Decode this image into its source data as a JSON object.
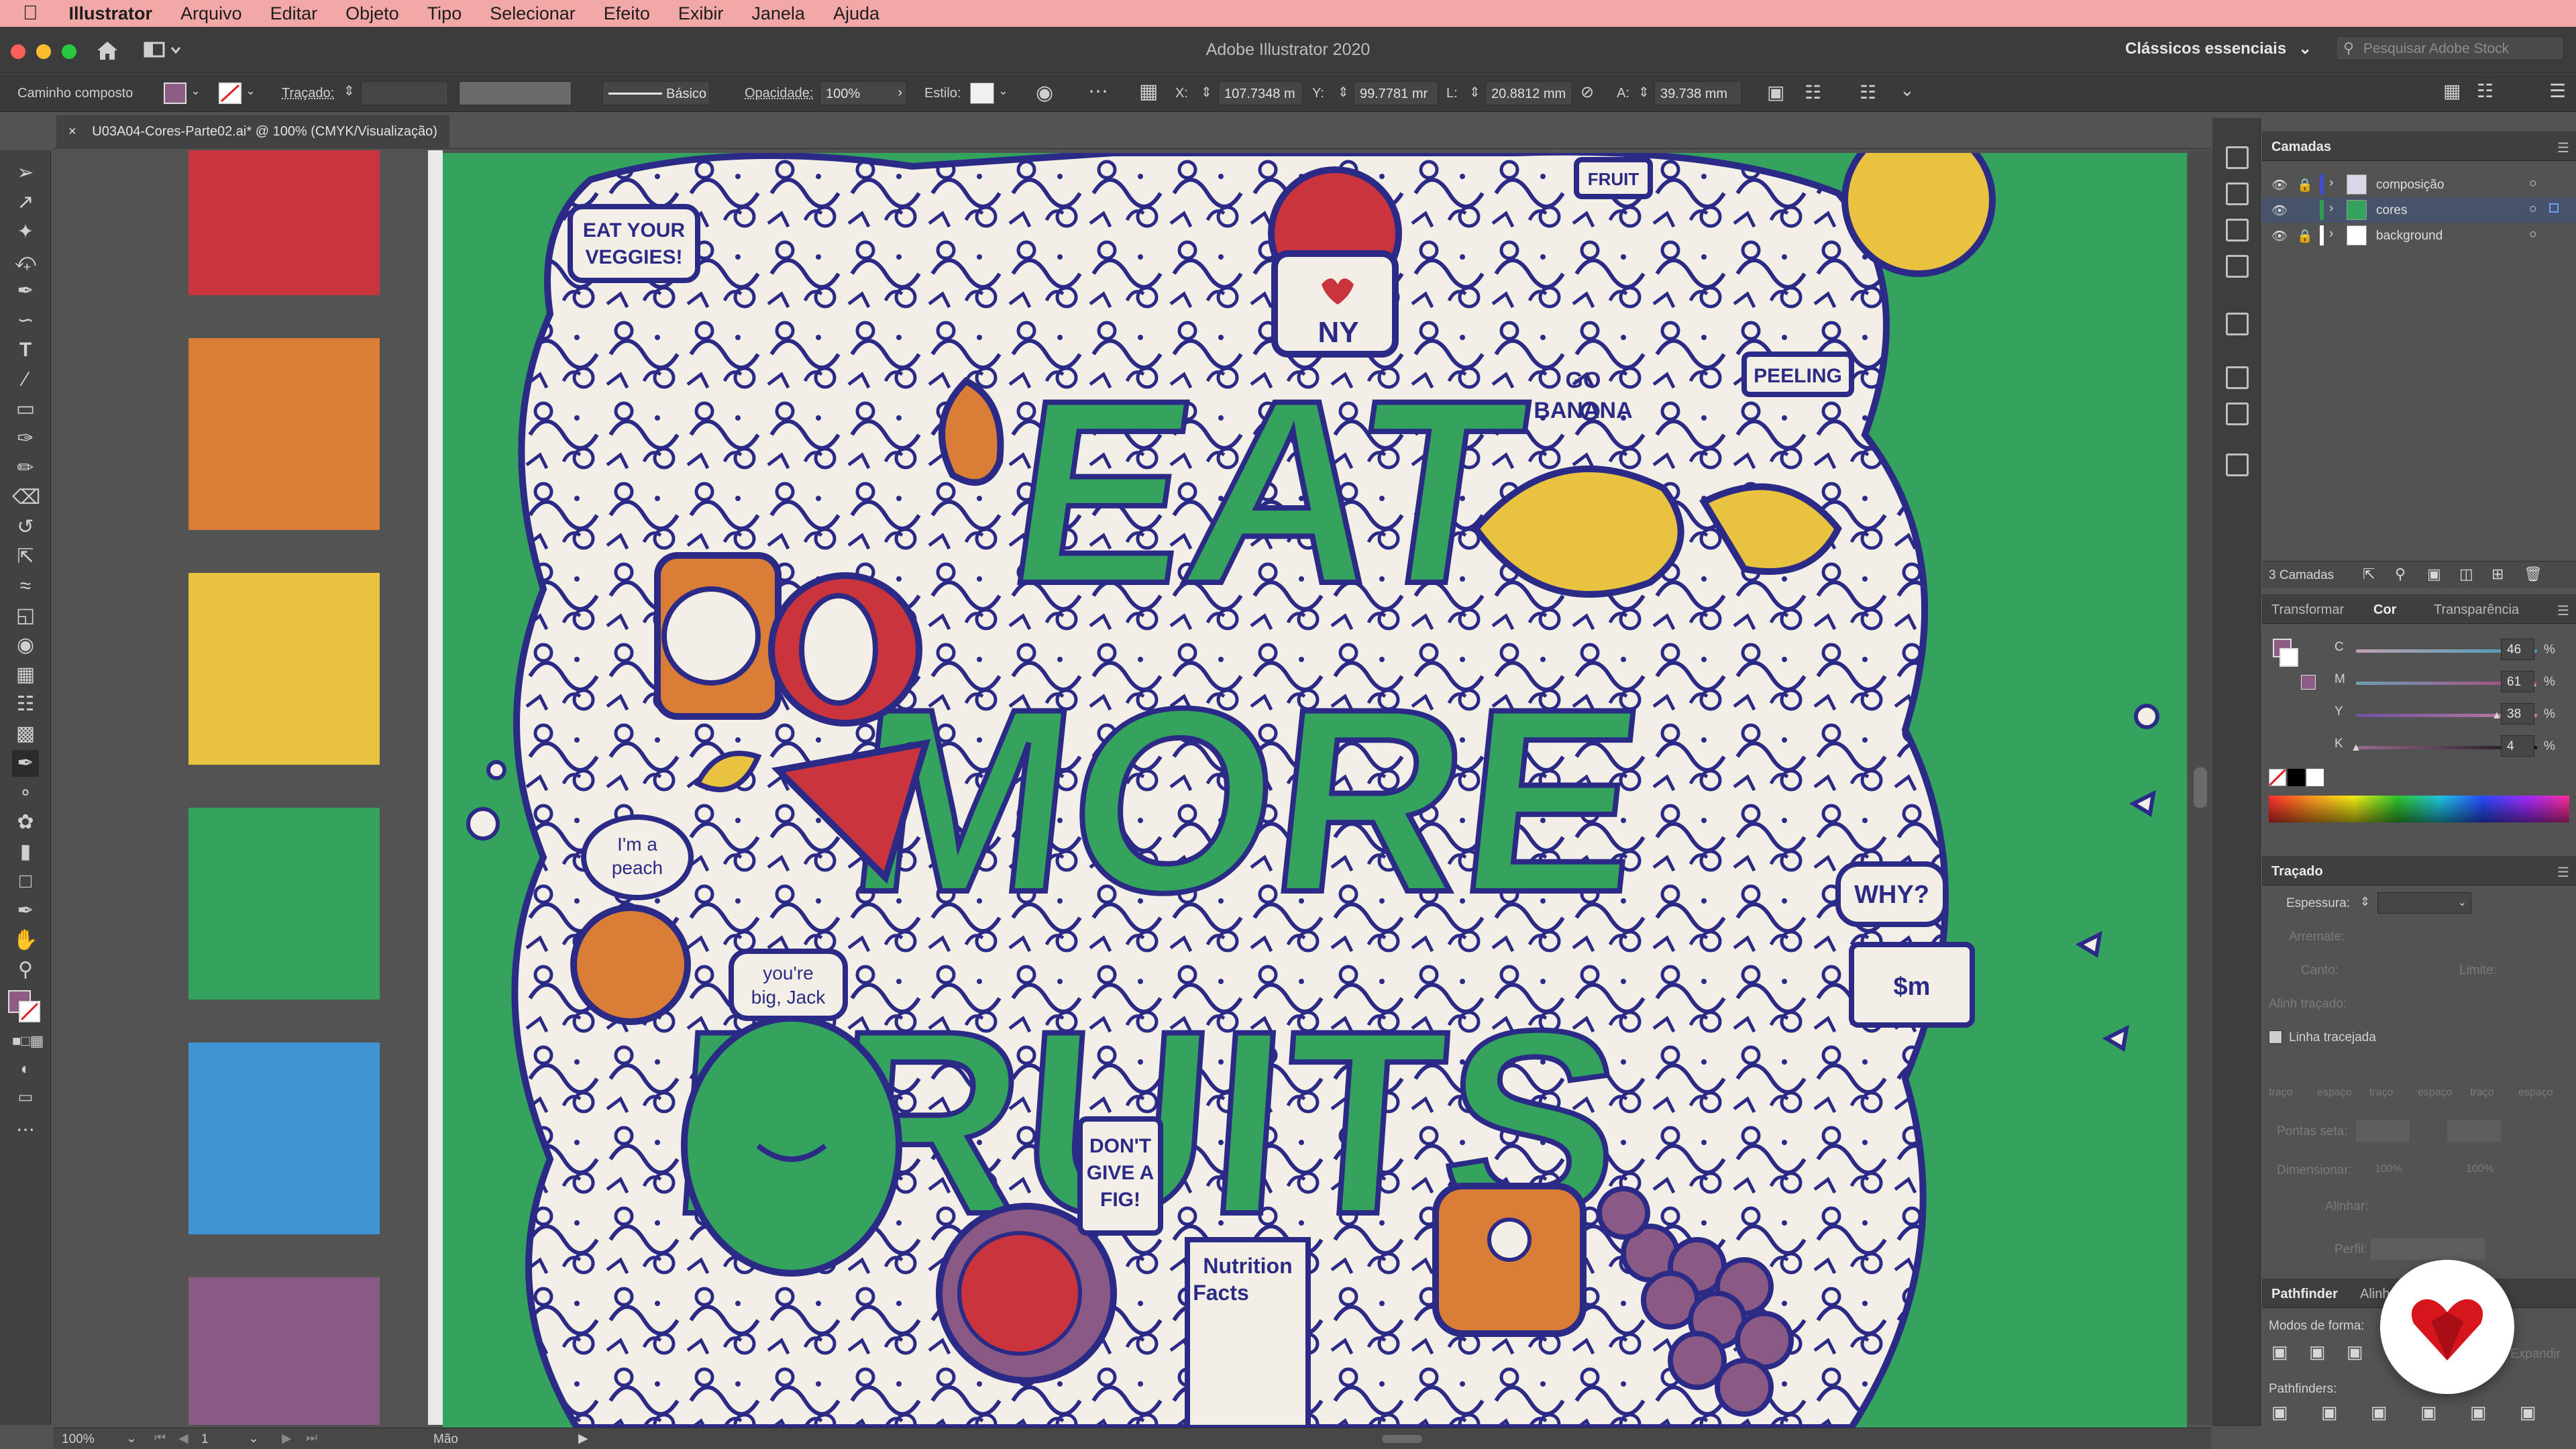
{
  "menubar": {
    "app": "Illustrator",
    "items": [
      "Arquivo",
      "Editar",
      "Objeto",
      "Tipo",
      "Selecionar",
      "Efeito",
      "Exibir",
      "Janela",
      "Ajuda"
    ]
  },
  "window": {
    "title": "Adobe Illustrator 2020",
    "workspace": "Clássicos essenciais",
    "stock_placeholder": "Pesquisar Adobe Stock"
  },
  "control_bar": {
    "selection": "Caminho composto",
    "stroke_label": "Traçado:",
    "brush": "Básico",
    "opacity_label": "Opacidade:",
    "opacity": "100%",
    "style_label": "Estilo:",
    "x_label": "X:",
    "x": "107.7348 m",
    "y_label": "Y:",
    "y": "99.7781 mr",
    "w_label": "L:",
    "w": "20.8812 mm",
    "h_label": "A:",
    "h": "39.738 mm"
  },
  "document": {
    "tab": "U03A04-Cores-Parte02.ai* @ 100% (CMYK/Visualização)",
    "close": "×"
  },
  "swatches": {
    "colors": [
      "#c9343d",
      "#d97d37",
      "#e9c340",
      "#34a35e",
      "#3f95d4",
      "#8a5a84"
    ]
  },
  "artwork": {
    "headline": [
      "EAT",
      "MORE",
      "FRUITS"
    ],
    "bubbles": {
      "veggies": [
        "EAT YOUR",
        "VEGGIES!"
      ],
      "go_banana": [
        "GO",
        "BANANA"
      ],
      "peeling": "PEELING",
      "why": "WHY?",
      "peach": [
        "I'm a",
        "peach"
      ],
      "jack": [
        "you're",
        "big, Jack"
      ],
      "fig": [
        "DON'T",
        "GIVE A",
        "FIG!"
      ],
      "nutrition": [
        "Nutrition",
        "Facts"
      ],
      "ny": "NY",
      "money": "$m",
      "fruit": "FRUIT"
    },
    "colors": {
      "bg": "#34a35e",
      "ink": "#2b2a86",
      "paper": "#f3efe6",
      "red": "#c9343d",
      "orange": "#d97d37",
      "yellow": "#e9c340",
      "purple": "#8a5a84"
    }
  },
  "layers_panel": {
    "title": "Camadas",
    "layers": [
      {
        "name": "composição",
        "color": "#3d4fd1",
        "selected": false
      },
      {
        "name": "cores",
        "color": "#2f9e4d",
        "selected": true
      },
      {
        "name": "background",
        "color": "#ffffff",
        "selected": false
      }
    ],
    "count": "3 Camadas"
  },
  "color_panel": {
    "tabs": [
      "Transformar",
      "Cor",
      "Transparência"
    ],
    "channels": [
      {
        "label": "C",
        "value": "46"
      },
      {
        "label": "M",
        "value": "61"
      },
      {
        "label": "Y",
        "value": "38"
      },
      {
        "label": "K",
        "value": "4"
      }
    ],
    "unit": "%"
  },
  "stroke_panel": {
    "title": "Traçado",
    "weight_label": "Espessura:",
    "cap_label": "Arremate:",
    "corner_label": "Canto:",
    "limit_label": "Limite:",
    "align_label": "Alinh traçado:",
    "dashed_label": "Linha tracejada",
    "dash_labels": [
      "traço",
      "espaço",
      "traço",
      "espaço",
      "traço",
      "espaço"
    ],
    "arrows_label": "Pontas seta:",
    "scale_label": "Dimensionar:",
    "align2_label": "Alinhar:",
    "profile_label": "Perfil:",
    "scale_values": [
      "100%",
      "100%"
    ]
  },
  "pathfinder": {
    "tabs": [
      "Pathfinder",
      "Alinh"
    ],
    "modes_label": "Modos de forma:",
    "pathfinders_label": "Pathfinders:",
    "expand": "Expandir"
  },
  "status": {
    "zoom": "100%",
    "artboard": "1",
    "tool": "Mão"
  }
}
